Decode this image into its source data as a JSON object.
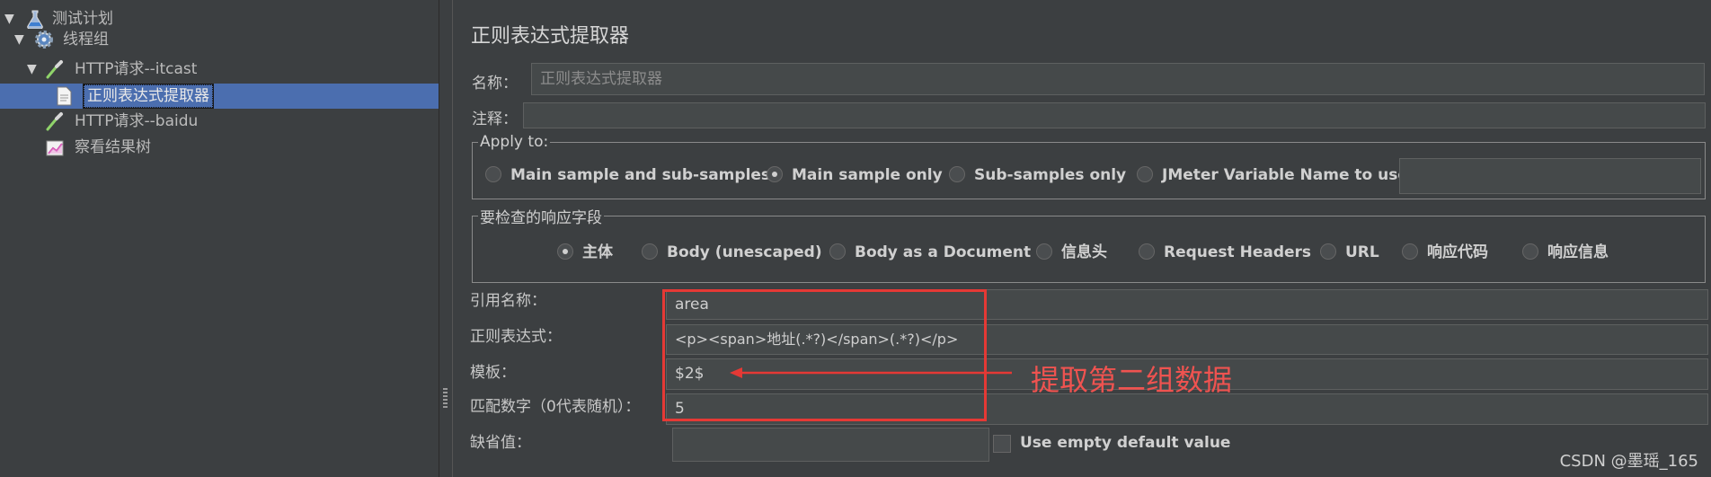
{
  "tree": {
    "items": [
      {
        "label": "测试计划",
        "icon": "flask-icon",
        "expanded": true
      },
      {
        "label": "线程组",
        "icon": "gear-icon",
        "expanded": true
      },
      {
        "label": "HTTP请求--itcast",
        "icon": "pipette-icon",
        "expanded": true
      },
      {
        "label": "正则表达式提取器",
        "icon": "document-icon",
        "selected": true
      },
      {
        "label": "HTTP请求--baidu",
        "icon": "pipette-icon"
      },
      {
        "label": "察看结果树",
        "icon": "chart-icon"
      }
    ]
  },
  "panel": {
    "title": "正则表达式提取器",
    "name_label": "名称：",
    "name_value": "正则表达式提取器",
    "comment_label": "注释：",
    "comment_value": ""
  },
  "apply_to": {
    "legend": "Apply to:",
    "options": [
      {
        "label": "Main sample and sub-samples",
        "selected": false
      },
      {
        "label": "Main sample only",
        "selected": true
      },
      {
        "label": "Sub-samples only",
        "selected": false
      },
      {
        "label": "JMeter Variable Name to use",
        "selected": false
      }
    ],
    "variable_value": ""
  },
  "response_field": {
    "legend": "要检查的响应字段",
    "options": [
      {
        "label": "主体",
        "selected": true
      },
      {
        "label": "Body (unescaped)",
        "selected": false
      },
      {
        "label": "Body as a Document",
        "selected": false
      },
      {
        "label": "信息头",
        "selected": false
      },
      {
        "label": "Request Headers",
        "selected": false
      },
      {
        "label": "URL",
        "selected": false
      },
      {
        "label": "响应代码",
        "selected": false
      },
      {
        "label": "响应信息",
        "selected": false
      }
    ]
  },
  "form": {
    "ref_name_label": "引用名称：",
    "ref_name_value": "area",
    "regex_label": "正则表达式：",
    "regex_value": "<p><span>地址(.*?)</span>(.*?)</p>",
    "template_label": "模板：",
    "template_value": "$2$",
    "match_no_label": "匹配数字（0代表随机）：",
    "match_no_value": "5",
    "default_label": "缺省值：",
    "default_value": "",
    "use_empty_label": "Use empty default value",
    "use_empty_checked": false
  },
  "annotation": {
    "text": "提取第二组数据",
    "color": "#e53935"
  },
  "watermark": "CSDN @墨瑶_165"
}
